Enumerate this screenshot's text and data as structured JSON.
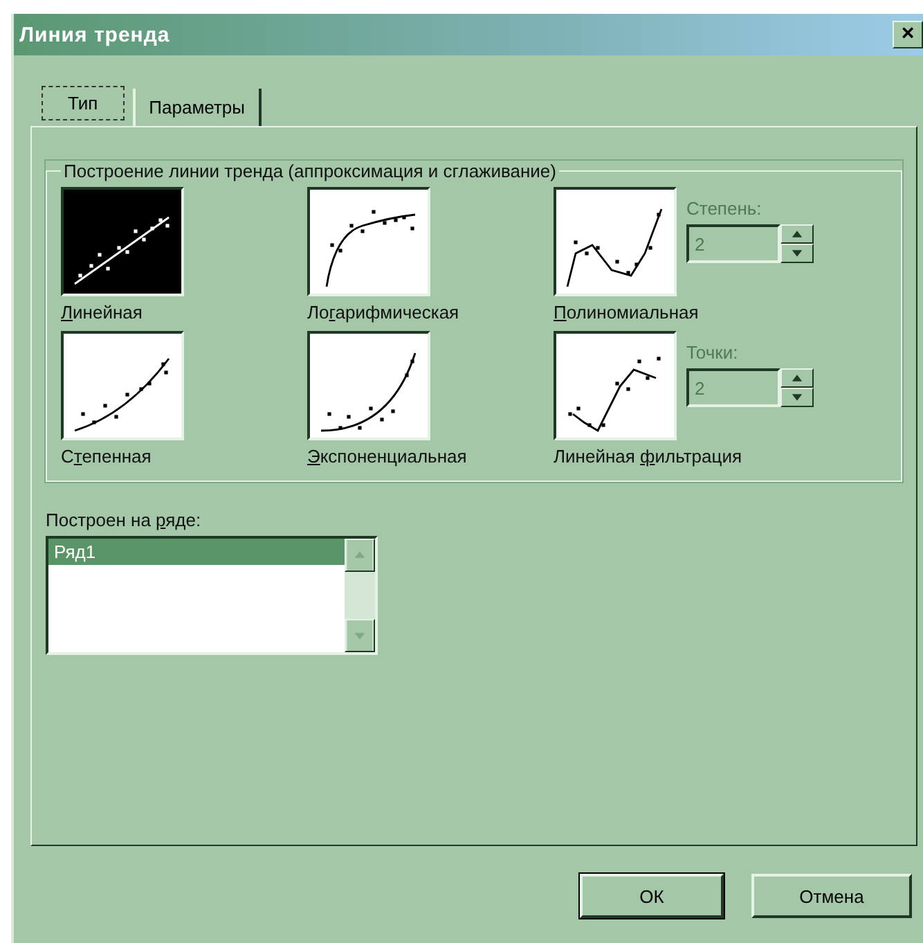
{
  "window": {
    "title": "Линия тренда",
    "close": "×"
  },
  "tabs": [
    {
      "label": "Тип",
      "selected": true
    },
    {
      "label": "Параметры",
      "selected": false
    }
  ],
  "group": {
    "title": "Построение линии тренда (аппроксимация и сглаживание)"
  },
  "types": [
    {
      "kind": "linear",
      "key": "Л",
      "post": "инейная",
      "selected": true
    },
    {
      "kind": "log",
      "pre": "Ло",
      "key": "г",
      "post": "арифмическая",
      "selected": false
    },
    {
      "kind": "poly",
      "key": "П",
      "post": "олиномиальная",
      "selected": false
    },
    {
      "kind": "power",
      "pre": "С",
      "key": "т",
      "post": "епенная",
      "selected": false
    },
    {
      "kind": "exp",
      "key": "Э",
      "post": "кспоненциальная",
      "selected": false
    },
    {
      "kind": "moving",
      "pre": "Линейная ",
      "key": "ф",
      "post": "ильтрация",
      "selected": false
    }
  ],
  "spinners": [
    {
      "label": "Степень:",
      "value": "2",
      "disabled": true
    },
    {
      "label": "Точки:",
      "value": "2",
      "disabled": true
    }
  ],
  "series_list": {
    "label_pre": "Построен на ",
    "label_key": "р",
    "label_post": "яде:",
    "items": [
      {
        "label": "Ряд1",
        "selected": true
      }
    ]
  },
  "buttons": [
    {
      "label": "ОК",
      "default": true
    },
    {
      "label": "Отмена",
      "default": false
    }
  ]
}
